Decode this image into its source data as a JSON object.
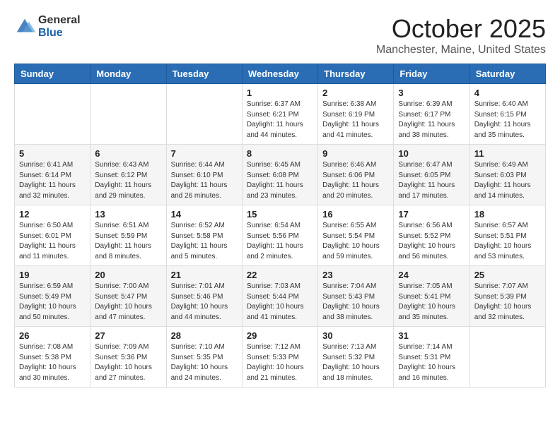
{
  "header": {
    "logo_general": "General",
    "logo_blue": "Blue",
    "month_title": "October 2025",
    "location": "Manchester, Maine, United States"
  },
  "days_of_week": [
    "Sunday",
    "Monday",
    "Tuesday",
    "Wednesday",
    "Thursday",
    "Friday",
    "Saturday"
  ],
  "weeks": [
    [
      {
        "day": "",
        "info": ""
      },
      {
        "day": "",
        "info": ""
      },
      {
        "day": "",
        "info": ""
      },
      {
        "day": "1",
        "info": "Sunrise: 6:37 AM\nSunset: 6:21 PM\nDaylight: 11 hours\nand 44 minutes."
      },
      {
        "day": "2",
        "info": "Sunrise: 6:38 AM\nSunset: 6:19 PM\nDaylight: 11 hours\nand 41 minutes."
      },
      {
        "day": "3",
        "info": "Sunrise: 6:39 AM\nSunset: 6:17 PM\nDaylight: 11 hours\nand 38 minutes."
      },
      {
        "day": "4",
        "info": "Sunrise: 6:40 AM\nSunset: 6:15 PM\nDaylight: 11 hours\nand 35 minutes."
      }
    ],
    [
      {
        "day": "5",
        "info": "Sunrise: 6:41 AM\nSunset: 6:14 PM\nDaylight: 11 hours\nand 32 minutes."
      },
      {
        "day": "6",
        "info": "Sunrise: 6:43 AM\nSunset: 6:12 PM\nDaylight: 11 hours\nand 29 minutes."
      },
      {
        "day": "7",
        "info": "Sunrise: 6:44 AM\nSunset: 6:10 PM\nDaylight: 11 hours\nand 26 minutes."
      },
      {
        "day": "8",
        "info": "Sunrise: 6:45 AM\nSunset: 6:08 PM\nDaylight: 11 hours\nand 23 minutes."
      },
      {
        "day": "9",
        "info": "Sunrise: 6:46 AM\nSunset: 6:06 PM\nDaylight: 11 hours\nand 20 minutes."
      },
      {
        "day": "10",
        "info": "Sunrise: 6:47 AM\nSunset: 6:05 PM\nDaylight: 11 hours\nand 17 minutes."
      },
      {
        "day": "11",
        "info": "Sunrise: 6:49 AM\nSunset: 6:03 PM\nDaylight: 11 hours\nand 14 minutes."
      }
    ],
    [
      {
        "day": "12",
        "info": "Sunrise: 6:50 AM\nSunset: 6:01 PM\nDaylight: 11 hours\nand 11 minutes."
      },
      {
        "day": "13",
        "info": "Sunrise: 6:51 AM\nSunset: 5:59 PM\nDaylight: 11 hours\nand 8 minutes."
      },
      {
        "day": "14",
        "info": "Sunrise: 6:52 AM\nSunset: 5:58 PM\nDaylight: 11 hours\nand 5 minutes."
      },
      {
        "day": "15",
        "info": "Sunrise: 6:54 AM\nSunset: 5:56 PM\nDaylight: 11 hours\nand 2 minutes."
      },
      {
        "day": "16",
        "info": "Sunrise: 6:55 AM\nSunset: 5:54 PM\nDaylight: 10 hours\nand 59 minutes."
      },
      {
        "day": "17",
        "info": "Sunrise: 6:56 AM\nSunset: 5:52 PM\nDaylight: 10 hours\nand 56 minutes."
      },
      {
        "day": "18",
        "info": "Sunrise: 6:57 AM\nSunset: 5:51 PM\nDaylight: 10 hours\nand 53 minutes."
      }
    ],
    [
      {
        "day": "19",
        "info": "Sunrise: 6:59 AM\nSunset: 5:49 PM\nDaylight: 10 hours\nand 50 minutes."
      },
      {
        "day": "20",
        "info": "Sunrise: 7:00 AM\nSunset: 5:47 PM\nDaylight: 10 hours\nand 47 minutes."
      },
      {
        "day": "21",
        "info": "Sunrise: 7:01 AM\nSunset: 5:46 PM\nDaylight: 10 hours\nand 44 minutes."
      },
      {
        "day": "22",
        "info": "Sunrise: 7:03 AM\nSunset: 5:44 PM\nDaylight: 10 hours\nand 41 minutes."
      },
      {
        "day": "23",
        "info": "Sunrise: 7:04 AM\nSunset: 5:43 PM\nDaylight: 10 hours\nand 38 minutes."
      },
      {
        "day": "24",
        "info": "Sunrise: 7:05 AM\nSunset: 5:41 PM\nDaylight: 10 hours\nand 35 minutes."
      },
      {
        "day": "25",
        "info": "Sunrise: 7:07 AM\nSunset: 5:39 PM\nDaylight: 10 hours\nand 32 minutes."
      }
    ],
    [
      {
        "day": "26",
        "info": "Sunrise: 7:08 AM\nSunset: 5:38 PM\nDaylight: 10 hours\nand 30 minutes."
      },
      {
        "day": "27",
        "info": "Sunrise: 7:09 AM\nSunset: 5:36 PM\nDaylight: 10 hours\nand 27 minutes."
      },
      {
        "day": "28",
        "info": "Sunrise: 7:10 AM\nSunset: 5:35 PM\nDaylight: 10 hours\nand 24 minutes."
      },
      {
        "day": "29",
        "info": "Sunrise: 7:12 AM\nSunset: 5:33 PM\nDaylight: 10 hours\nand 21 minutes."
      },
      {
        "day": "30",
        "info": "Sunrise: 7:13 AM\nSunset: 5:32 PM\nDaylight: 10 hours\nand 18 minutes."
      },
      {
        "day": "31",
        "info": "Sunrise: 7:14 AM\nSunset: 5:31 PM\nDaylight: 10 hours\nand 16 minutes."
      },
      {
        "day": "",
        "info": ""
      }
    ]
  ]
}
